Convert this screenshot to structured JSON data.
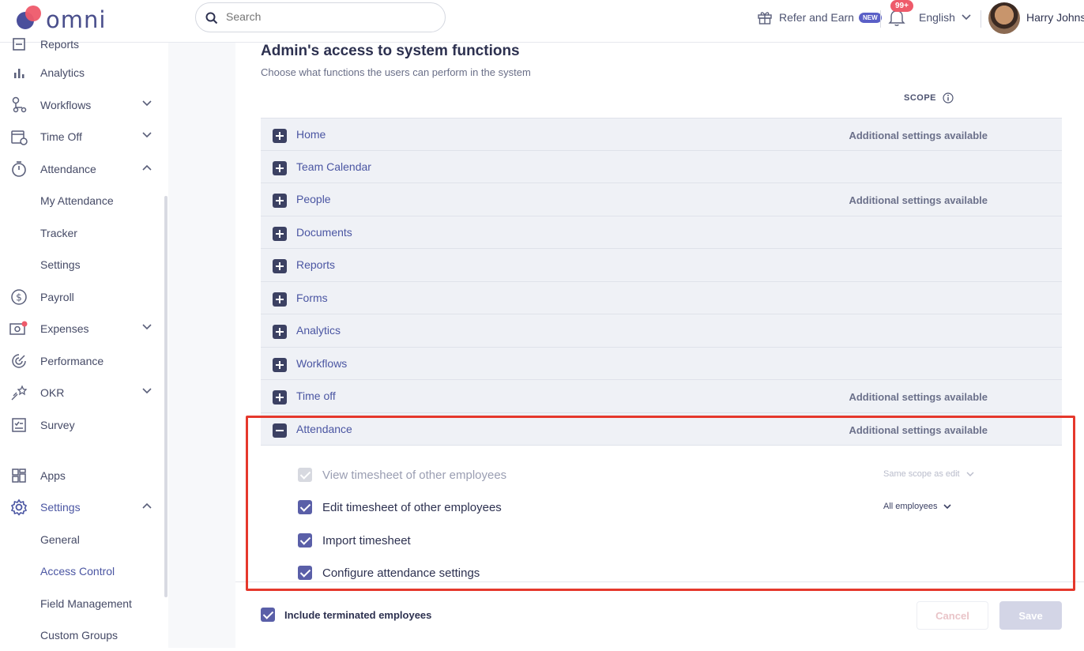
{
  "header": {
    "logo_text": "omni",
    "search_placeholder": "Search",
    "refer_label": "Refer and Earn",
    "new_badge": "NEW",
    "notification_count": "99+",
    "language": "English",
    "user_name": "Harry Johns"
  },
  "sidebar": {
    "items": [
      {
        "label": "Reports"
      },
      {
        "label": "Analytics"
      },
      {
        "label": "Workflows"
      },
      {
        "label": "Time Off"
      },
      {
        "label": "Attendance"
      },
      {
        "label": "My Attendance"
      },
      {
        "label": "Tracker"
      },
      {
        "label": "Settings"
      },
      {
        "label": "Payroll"
      },
      {
        "label": "Expenses"
      },
      {
        "label": "Performance"
      },
      {
        "label": "OKR"
      },
      {
        "label": "Survey"
      },
      {
        "label": "Apps"
      },
      {
        "label": "Settings"
      },
      {
        "label": "General"
      },
      {
        "label": "Access Control"
      },
      {
        "label": "Field Management"
      },
      {
        "label": "Custom Groups"
      }
    ]
  },
  "main": {
    "title": "Admin's access to system functions",
    "subtitle": "Choose what functions the users can perform in the system",
    "scope_header": "SCOPE",
    "rows": [
      {
        "label": "Home",
        "extra": "Additional settings available"
      },
      {
        "label": "Team Calendar",
        "extra": ""
      },
      {
        "label": "People",
        "extra": "Additional settings available"
      },
      {
        "label": "Documents",
        "extra": ""
      },
      {
        "label": "Reports",
        "extra": ""
      },
      {
        "label": "Forms",
        "extra": ""
      },
      {
        "label": "Analytics",
        "extra": ""
      },
      {
        "label": "Workflows",
        "extra": ""
      },
      {
        "label": "Time off",
        "extra": "Additional settings available"
      },
      {
        "label": "Attendance",
        "extra": "Additional settings available"
      }
    ],
    "attendance_permissions": [
      {
        "label": "View timesheet of other employees",
        "scope": "Same scope as edit"
      },
      {
        "label": "Edit timesheet of other employees",
        "scope": "All employees"
      },
      {
        "label": "Import timesheet",
        "scope": ""
      },
      {
        "label": "Configure attendance settings",
        "scope": ""
      }
    ]
  },
  "footer": {
    "include_terminated": "Include terminated employees",
    "cancel": "Cancel",
    "save": "Save"
  },
  "colors": {
    "accent": "#5a5fa8",
    "highlight": "#e5382c",
    "logo_dot": "#ee5a6a"
  }
}
